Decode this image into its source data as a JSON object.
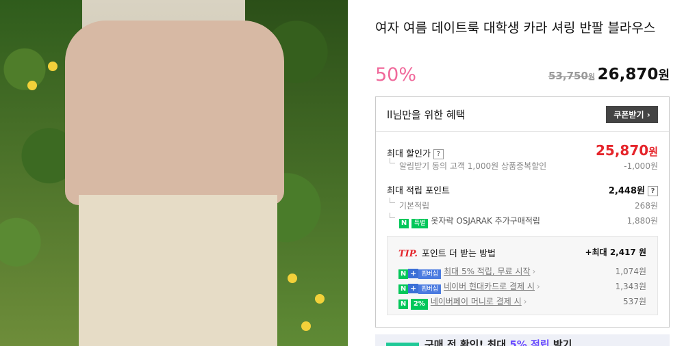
{
  "product": {
    "title": "여자 여름 데이트룩 대학생 카라 셔링 반팔 블라우스",
    "discount_rate": "50%",
    "original_price": "53,750",
    "original_unit": "원",
    "sale_price": "26,870",
    "sale_unit": "원"
  },
  "benefits": {
    "heading": "ll님만을 위한 혜택",
    "coupon_button": "쿠폰받기",
    "max_discount_label": "최대 할인가",
    "max_discount_value": "25,870",
    "max_discount_unit": "원",
    "alarm_label": "알림받기 동의 고객 1,000원 상품중복할인",
    "alarm_value": "-1,000원",
    "max_points_label": "최대 적립 포인트",
    "max_points_value": "2,448원",
    "basic_points_label": "기본적립",
    "basic_points_value": "268원",
    "special_tag": "특별",
    "extra_points_label": "옷자락 OSJARAK 추가구매적립",
    "extra_points_value": "1,880원"
  },
  "tip": {
    "tip_word": "TIP.",
    "title": "포인트 더 받는 방법",
    "max": "+최대 2,417 원",
    "rows": [
      {
        "badge": "멤버십",
        "label": "최대 5% 적립, 무료 시작",
        "value": "1,074원"
      },
      {
        "badge": "멤버십",
        "label": "네이버 현대카드로 결제 시",
        "value": "1,343원"
      },
      {
        "badge": "2%",
        "label": "네이버페이 머니로 결제 시",
        "value": "537원"
      }
    ]
  },
  "bottom_banner": {
    "text_a": "구매 전 확인! 최대 ",
    "highlight": "5% 적립",
    "text_b": " 받기"
  },
  "colors": {
    "discount_pink": "#f0699b",
    "price_red": "#e5252b",
    "naver_green": "#03c75a",
    "membership_blue": "#4b7be0"
  }
}
